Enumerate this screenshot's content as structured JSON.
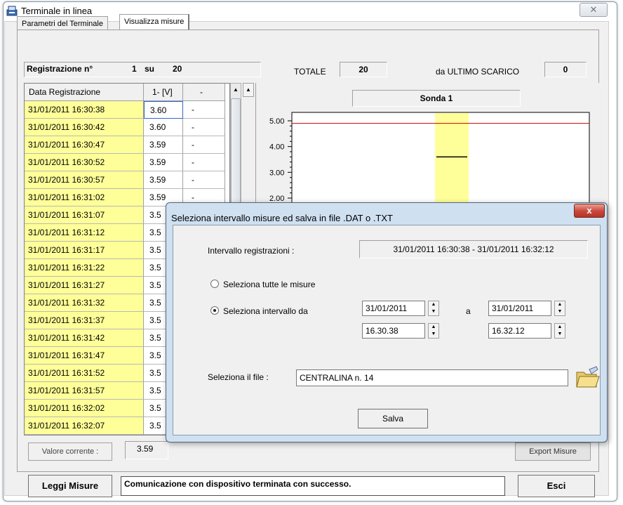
{
  "window": {
    "title": "Terminale in linea",
    "close_glyph": "✕"
  },
  "tabs": [
    {
      "label": "Parametri del Terminale",
      "active": false
    },
    {
      "label": "Visualizza misure",
      "active": true
    }
  ],
  "header": {
    "reg_label": "Registrazione n°",
    "reg_current": "1",
    "reg_su": "su",
    "reg_total": "20",
    "totale_label": "TOTALE",
    "totale_value": "20",
    "ultimo_label": "da ULTIMO SCARICO",
    "ultimo_value": "0"
  },
  "table": {
    "columns": [
      "Data Registrazione",
      "1- [V]",
      "-"
    ],
    "rows": [
      {
        "date": "31/01/2011 16:30:38",
        "v": "3.60",
        "c": "-"
      },
      {
        "date": "31/01/2011 16:30:42",
        "v": "3.60",
        "c": "-"
      },
      {
        "date": "31/01/2011 16:30:47",
        "v": "3.59",
        "c": "-"
      },
      {
        "date": "31/01/2011 16:30:52",
        "v": "3.59",
        "c": "-"
      },
      {
        "date": "31/01/2011 16:30:57",
        "v": "3.59",
        "c": "-"
      },
      {
        "date": "31/01/2011 16:31:02",
        "v": "3.59",
        "c": "-"
      },
      {
        "date": "31/01/2011 16:31:07",
        "v": "3.5",
        "c": ""
      },
      {
        "date": "31/01/2011 16:31:12",
        "v": "3.5",
        "c": ""
      },
      {
        "date": "31/01/2011 16:31:17",
        "v": "3.5",
        "c": ""
      },
      {
        "date": "31/01/2011 16:31:22",
        "v": "3.5",
        "c": ""
      },
      {
        "date": "31/01/2011 16:31:27",
        "v": "3.5",
        "c": ""
      },
      {
        "date": "31/01/2011 16:31:32",
        "v": "3.5",
        "c": ""
      },
      {
        "date": "31/01/2011 16:31:37",
        "v": "3.5",
        "c": ""
      },
      {
        "date": "31/01/2011 16:31:42",
        "v": "3.5",
        "c": ""
      },
      {
        "date": "31/01/2011 16:31:47",
        "v": "3.5",
        "c": ""
      },
      {
        "date": "31/01/2011 16:31:52",
        "v": "3.5",
        "c": ""
      },
      {
        "date": "31/01/2011 16:31:57",
        "v": "3.5",
        "c": ""
      },
      {
        "date": "31/01/2011 16:32:02",
        "v": "3.5",
        "c": ""
      },
      {
        "date": "31/01/2011 16:32:07",
        "v": "3.5",
        "c": ""
      }
    ]
  },
  "chart": {
    "title": "Sonda 1"
  },
  "chart_data": {
    "type": "line",
    "title": "Sonda 1",
    "y_ticks": [
      "5.00",
      "4.00",
      "3.00",
      "2.00"
    ],
    "ylim": [
      2.0,
      5.0
    ],
    "threshold": 4.9,
    "marker_value": 3.6,
    "colors": {
      "threshold": "#cc0000",
      "highlight": "#ffff99",
      "marker": "#000000"
    }
  },
  "bottom": {
    "valore_label": "Valore corrente :",
    "valore_value": "3.59",
    "export_label": "Export Misure",
    "leggi_label": "Leggi Misure",
    "status_text": "Comunicazione con dispositivo terminata con successo.",
    "esci_label": "Esci"
  },
  "dialog": {
    "title": "Seleziona intervallo misure ed salva in file .DAT o .TXT",
    "close_glyph": "x",
    "interval_label": "Intervallo registrazioni :",
    "interval_value": "31/01/2011 16:30:38  -  31/01/2011 16:32:12",
    "radio_all": "Seleziona tutte le misure",
    "radio_range": "Seleziona intervallo da",
    "date_from": "31/01/2011",
    "time_from": "16.30.38",
    "a_label": "a",
    "date_to": "31/01/2011",
    "time_to": "16.32.12",
    "file_label": "Seleziona il file :",
    "file_value": "CENTRALINA  n. 14",
    "save_label": "Salva"
  },
  "icons": {
    "app": "terminal-icon",
    "folder": "folder-open-icon",
    "spin_up": "▲",
    "spin_down": "▼"
  }
}
